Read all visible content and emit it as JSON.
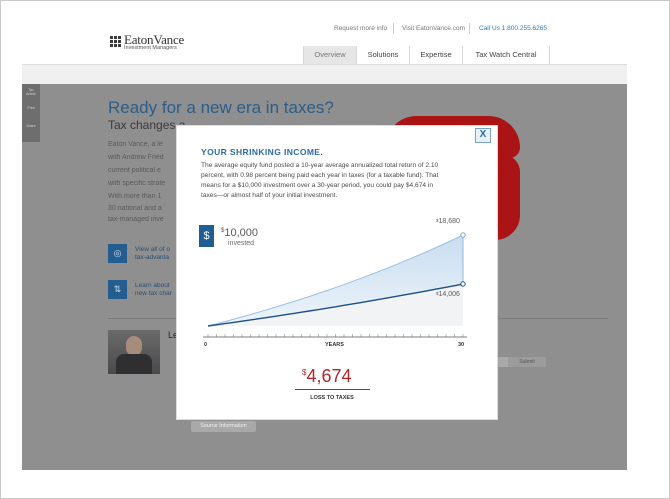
{
  "header": {
    "logo_name": "EatonVance",
    "logo_sub": "Investment Managers",
    "utility_links": [
      "Request more info",
      "Visit EatonVance.com"
    ],
    "phone_prefix": "Call Us",
    "phone_number": "1.800.255.6265",
    "nav_tabs": [
      {
        "label": "Overview",
        "active": true
      },
      {
        "label": "Solutions",
        "active": false
      },
      {
        "label": "Expertise",
        "active": false
      },
      {
        "label": "Tax Watch Central",
        "active": false
      }
    ]
  },
  "sidebar": {
    "items": [
      "Tax Article",
      "Print",
      "Share"
    ]
  },
  "hero": {
    "title": "Ready for a new era in taxes?",
    "subtitle": "Tax changes a",
    "body_lines": [
      "Eaton Vance, a le",
      "with Andrew Fried",
      "current political e",
      "with specific strate",
      "With more than 1",
      "30 national and a",
      "tax-managed inve"
    ]
  },
  "features": [
    {
      "icon": "globe-icon",
      "line1": "View all of o",
      "line2": "tax-advanta"
    },
    {
      "icon": "arrows-icon",
      "line1": "Learn about",
      "line2": "new tax char"
    }
  ],
  "profile": {
    "name_partial": "Le",
    "submit_label": "Submit"
  },
  "source_button": "Source Information",
  "modal": {
    "close_label": "X",
    "title": "YOUR SHRINKING INCOME.",
    "body": [
      "The average equity fund posted a 10-year average annualized total return of 2.10",
      "percent, with 0.98 percent being paid each year in taxes (for a taxable fund). That",
      "means for a $10,000 investment over a 30-year period, you could pay $4,674 in",
      "taxes—or almost half of your initial investment."
    ],
    "badge_symbol": "$",
    "invested_currency": "$",
    "invested_amount": "10,000",
    "invested_label": "invested",
    "loss_currency": "$",
    "loss_amount": "4,674",
    "loss_label": "LOSS TO TAXES"
  },
  "chart_data": {
    "type": "area",
    "x": [
      0,
      30
    ],
    "xlabel": "YEARS",
    "x_tick_labels": [
      "0",
      "30"
    ],
    "series": [
      {
        "values": [
          10000,
          18680
        ]
      },
      {
        "values": [
          10000,
          14006
        ]
      }
    ],
    "end_labels": [
      {
        "currency": "$",
        "value": "18,680"
      },
      {
        "currency": "$",
        "value": "14,006"
      }
    ],
    "colors": {
      "fill": "#c8ddf0",
      "line": "#1f4f86",
      "accent": "#b3262a"
    }
  }
}
